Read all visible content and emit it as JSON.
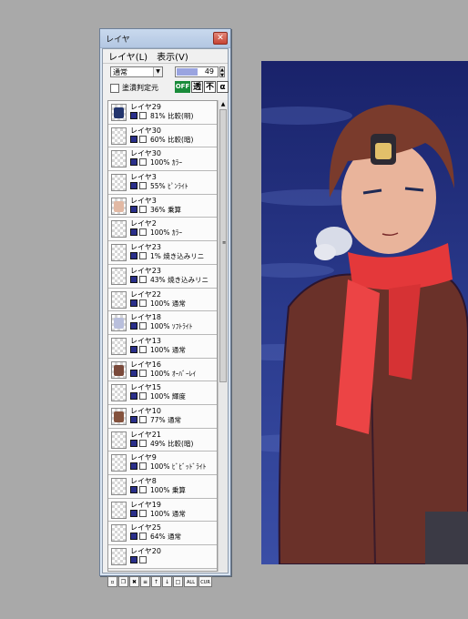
{
  "window": {
    "title": "レイヤ",
    "close_label": "✕"
  },
  "menu": {
    "items": [
      "レイヤ(L)",
      "表示(V)"
    ]
  },
  "blend": {
    "mode": "通常",
    "opacity_value": "49",
    "opacity_fraction": 0.49
  },
  "clip": {
    "label": "塗潰判定元"
  },
  "toggles": {
    "off_label": "OFF",
    "t1": "透",
    "t2": "不",
    "t3": "α"
  },
  "layers": [
    {
      "name": "レイヤ29",
      "opacity": "81%",
      "mode": "比較(明)",
      "mark": "#24366e"
    },
    {
      "name": "レイヤ30",
      "opacity": "60%",
      "mode": "比較(暗)",
      "mark": ""
    },
    {
      "name": "レイヤ30",
      "opacity": "100%",
      "mode": "ｶﾗｰ",
      "mark": ""
    },
    {
      "name": "レイヤ3",
      "opacity": "55%",
      "mode": "ﾋﾟﾝﾗｲﾄ",
      "mark": ""
    },
    {
      "name": "レイヤ3",
      "opacity": "36%",
      "mode": "乗算",
      "mark": "#e2b9a4"
    },
    {
      "name": "レイヤ2",
      "opacity": "100%",
      "mode": "ｶﾗｰ",
      "mark": ""
    },
    {
      "name": "レイヤ23",
      "opacity": "1%",
      "mode": "焼き込みリニ",
      "mark": ""
    },
    {
      "name": "レイヤ23",
      "opacity": "43%",
      "mode": "焼き込みリニ",
      "mark": ""
    },
    {
      "name": "レイヤ22",
      "opacity": "100%",
      "mode": "通常",
      "mark": ""
    },
    {
      "name": "レイヤ18",
      "opacity": "100%",
      "mode": "ｿﾌﾄﾗｲﾄ",
      "mark": "#b9bfdc"
    },
    {
      "name": "レイヤ13",
      "opacity": "100%",
      "mode": "通常",
      "mark": ""
    },
    {
      "name": "レイヤ16",
      "opacity": "100%",
      "mode": "ｵｰﾊﾞｰﾚｲ",
      "mark": "#7a4a3b"
    },
    {
      "name": "レイヤ15",
      "opacity": "100%",
      "mode": "輝度",
      "mark": ""
    },
    {
      "name": "レイヤ10",
      "opacity": "77%",
      "mode": "通常",
      "mark": "#84523d"
    },
    {
      "name": "レイヤ21",
      "opacity": "49%",
      "mode": "比較(暗)",
      "mark": ""
    },
    {
      "name": "レイヤ9",
      "opacity": "100%",
      "mode": "ﾋﾞﾋﾞｯﾄﾞﾗｲﾄ",
      "mark": ""
    },
    {
      "name": "レイヤ8",
      "opacity": "100%",
      "mode": "乗算",
      "mark": ""
    },
    {
      "name": "レイヤ19",
      "opacity": "100%",
      "mode": "通常",
      "mark": ""
    },
    {
      "name": "レイヤ25",
      "opacity": "64%",
      "mode": "通常",
      "mark": ""
    },
    {
      "name": "レイヤ20",
      "opacity": "",
      "mode": "",
      "mark": ""
    }
  ],
  "bottom_buttons": [
    "new-layer",
    "new-set",
    "delete",
    "merge",
    "move-up",
    "move-down",
    "clear",
    "ALL",
    "CUR"
  ],
  "bottom_labels": [
    "▫",
    "❐",
    "✖",
    "≡",
    "↑",
    "↓",
    "□",
    "ALL",
    "CUR"
  ],
  "colors": {
    "bg": "#a9a9a9",
    "accent_off": "#1a8b3a",
    "canvas_bg": "#1d2a66"
  }
}
